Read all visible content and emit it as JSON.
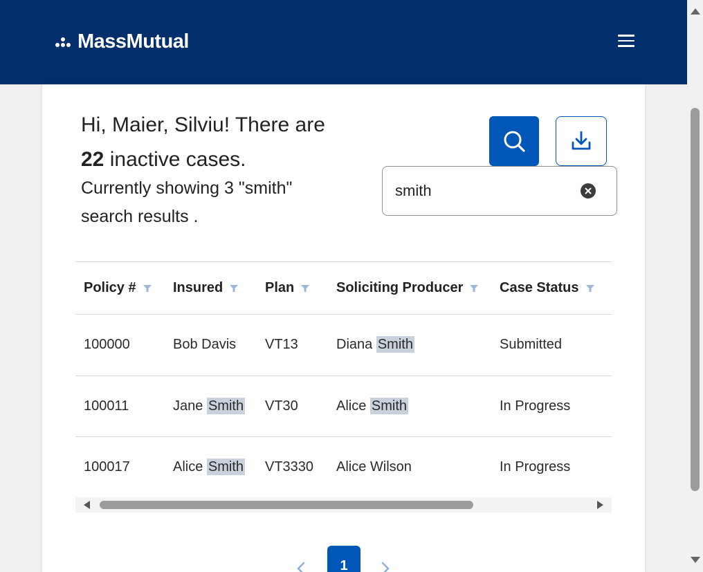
{
  "header": {
    "logo_text": "MassMutual",
    "bg_color": "#002f6c",
    "menu_icon": "hamburger-icon"
  },
  "intro": {
    "greeting_prefix": "Hi, Maier, Silviu! There are",
    "case_count": "22",
    "greeting_suffix": "inactive cases.",
    "showing_text": "Currently showing 3 \"smith\" search results ."
  },
  "search": {
    "value": "smith",
    "search_icon": "search-icon",
    "download_icon": "download-icon",
    "clear_icon": "clear-icon"
  },
  "table": {
    "columns": [
      "Policy #",
      "Insured",
      "Plan",
      "Soliciting Producer",
      "Case Status"
    ],
    "rows": [
      {
        "policy": "100000",
        "insured_first": "Bob Davis",
        "insured_hl": "",
        "plan": "VT13",
        "producer_first": "Diana ",
        "producer_hl": "Smith",
        "status": "Submitted"
      },
      {
        "policy": "100011",
        "insured_first": "Jane ",
        "insured_hl": "Smith",
        "plan": "VT30",
        "producer_first": "Alice ",
        "producer_hl": "Smith",
        "status": "In Progress"
      },
      {
        "policy": "100017",
        "insured_first": "Alice ",
        "insured_hl": "Smith",
        "plan": "VT3330",
        "producer_first": "Alice Wilson",
        "producer_hl": "",
        "status": "In Progress"
      }
    ]
  },
  "pagination": {
    "current_page": "1",
    "prev_icon": "chevron-left-icon",
    "next_icon": "chevron-right-icon"
  },
  "colors": {
    "accent": "#0057b8",
    "highlight": "#c8d1dc",
    "filter_icon": "#9bb8d8"
  }
}
